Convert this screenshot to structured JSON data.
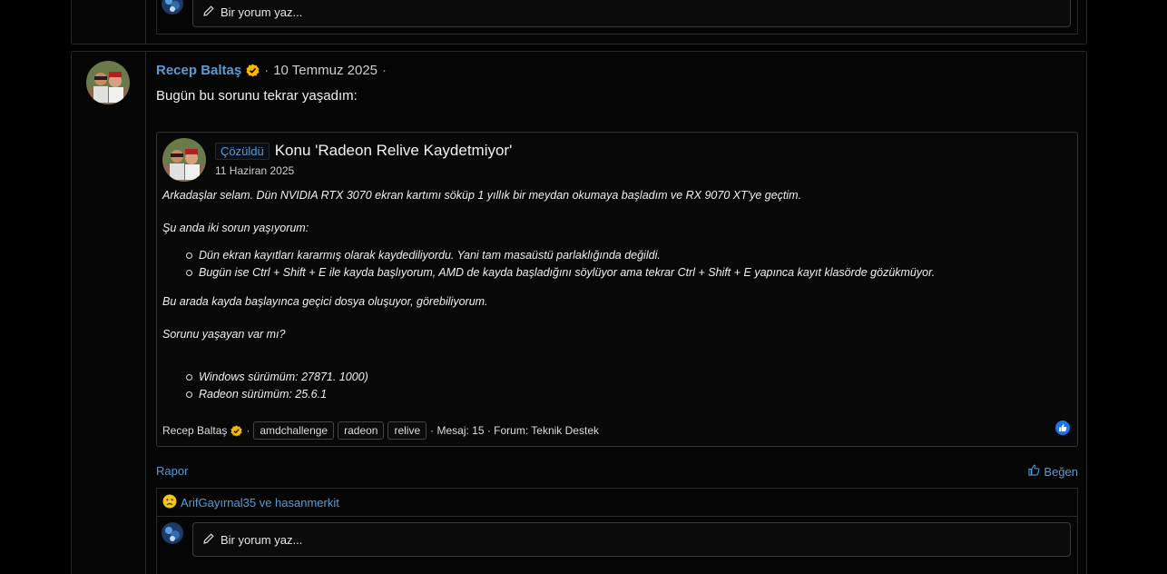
{
  "top_post": {
    "comment_placeholder": "Bir yorum yaz..."
  },
  "post": {
    "author": "Recep Baltaş",
    "separator": "·",
    "date": "10 Temmuz 2025",
    "body": "Bugün bu sorunu tekrar yaşadım:",
    "quote": {
      "status": "Çözüldü",
      "title": "Konu 'Radeon Relive Kaydetmiyor'",
      "date": "11 Haziran 2025",
      "paragraph1": "Arkadaşlar selam. Dün NVIDIA RTX 3070 ekran kartımı söküp 1 yıllık bir meydan okumaya başladım ve RX 9070 XT'ye geçtim.",
      "paragraph2": "Şu anda iki sorun yaşıyorum:",
      "list1": [
        "Dün ekran kayıtları kararmış olarak kaydediliyordu. Yani tam masaüstü parlaklığında değildi.",
        "Bugün ise Ctrl + Shift + E ile kayda başlıyorum, AMD de kayda başladığını söylüyor ama tekrar Ctrl + Shift + E yapınca kayıt klasörde gözükmüyor."
      ],
      "paragraph3": "Bu arada kayda başlayınca geçici dosya oluşuyor, görebiliyorum.",
      "paragraph4": "Sorunu yaşayan var mı?",
      "list2": [
        "Windows sürümüm: 27871. 1000)",
        "Radeon sürümüm: 25.6.1"
      ],
      "footer": {
        "author": "Recep Baltaş",
        "sep": "·",
        "tags": [
          "amdchallenge",
          "radeon",
          "relive"
        ],
        "meta": "· Mesaj: 15 · Forum: Teknik Destek"
      }
    },
    "report_label": "Rapor",
    "like_label": "Beğen",
    "reactions_text": "ArifGayırnal35 ve hasanmerkit",
    "comment_placeholder": "Bir yorum yaz..."
  },
  "colors": {
    "link": "#5b9bd5",
    "verified": "#f5b800",
    "like_badge": "#1877f2",
    "background": "#000000"
  }
}
